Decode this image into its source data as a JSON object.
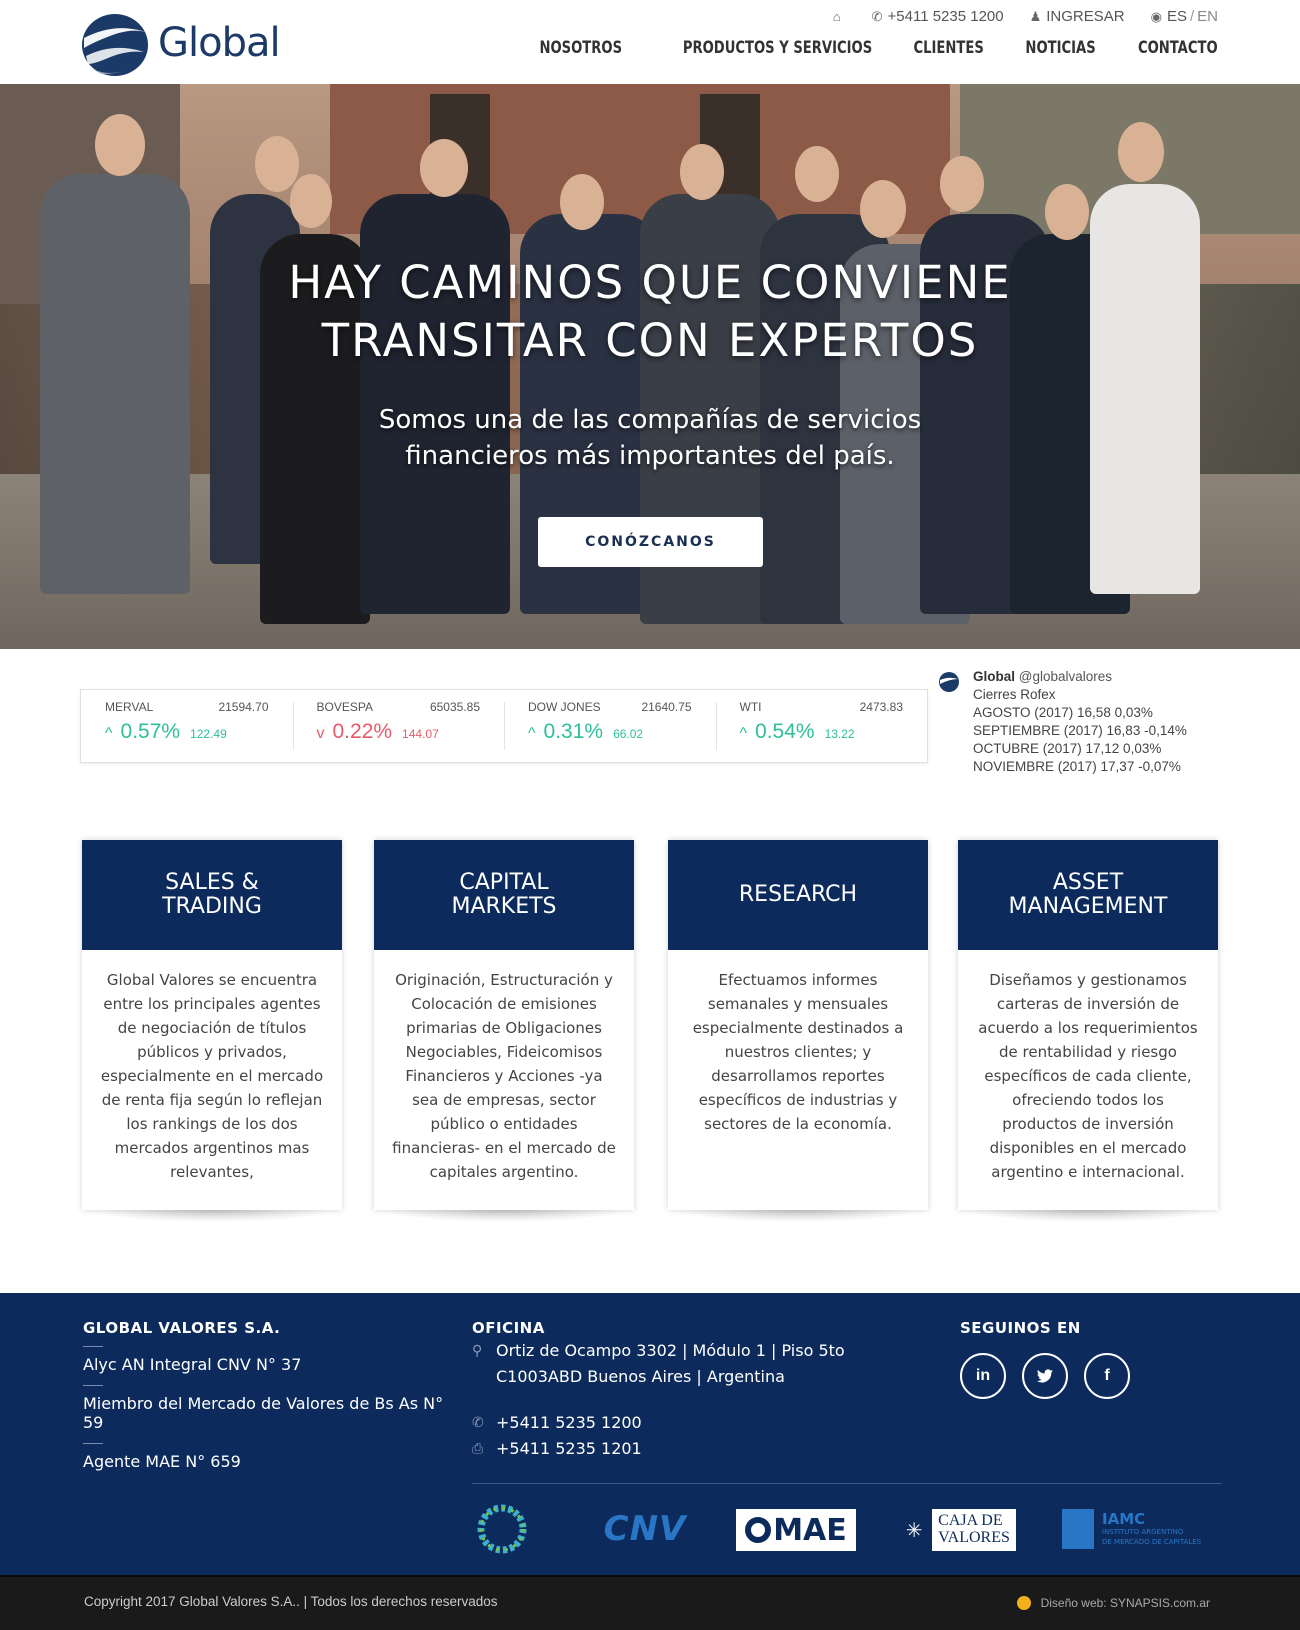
{
  "header": {
    "logo_text": "Global",
    "phone": "+5411 5235 1200",
    "login": "INGRESAR",
    "lang_es": "ES",
    "lang_sep": "/",
    "lang_en": "EN",
    "nav": [
      "NOSOTROS",
      "PRODUCTOS Y SERVICIOS",
      "CLIENTES",
      "NOTICIAS",
      "CONTACTO"
    ]
  },
  "hero": {
    "title_line1": "HAY CAMINOS QUE CONVIENE",
    "title_line2": "TRANSITAR CON EXPERTOS",
    "subtitle_line1": "Somos una de las compañías de servicios",
    "subtitle_line2": "financieros más importantes del país.",
    "button": "CONÓZCANOS"
  },
  "ticker": [
    {
      "name": "MERVAL",
      "value": "21594.70",
      "pct": "0.57%",
      "change": "122.49",
      "dir": "up",
      "arrow": "^"
    },
    {
      "name": "BOVESPA",
      "value": "65035.85",
      "pct": "0.22%",
      "change": "144.07",
      "dir": "down",
      "arrow": "v"
    },
    {
      "name": "DOW JONES",
      "value": "21640.75",
      "pct": "0.31%",
      "change": "66.02",
      "dir": "up",
      "arrow": "^"
    },
    {
      "name": "WTI",
      "value": "2473.83",
      "pct": "0.54%",
      "change": "13.22",
      "dir": "up",
      "arrow": "^"
    }
  ],
  "tweet": {
    "name": "Global",
    "handle": "@globalvalores",
    "lines": [
      "Cierres Rofex",
      "AGOSTO (2017) 16,58 0,03%",
      "SEPTIEMBRE (2017) 16,83 -0,14%",
      "OCTUBRE (2017) 17,12 0,03%",
      "NOVIEMBRE (2017) 17,37 -0,07%"
    ]
  },
  "cards": [
    {
      "title_line1": "SALES &",
      "title_line2": "TRADING",
      "body": "Global Valores se encuentra entre los principales agentes de negociación de títulos públicos y privados, especialmente en el mercado de renta fija según lo reflejan los rankings de los dos mercados argentinos mas relevantes,"
    },
    {
      "title_line1": "CAPITAL",
      "title_line2": "MARKETS",
      "body": "Originación, Estructuración y Colocación de emisiones primarias de Obligaciones Negociables, Fideicomisos Financieros y Acciones -ya sea de empresas, sector público o entidades financieras- en el mercado de capitales argentino."
    },
    {
      "title_line1": "RESEARCH",
      "title_line2": "",
      "body": "Efectuamos informes semanales y mensuales especialmente destinados a nuestros clientes; y desarrollamos reportes específicos de industrias y sectores de la economía."
    },
    {
      "title_line1": "ASSET",
      "title_line2": "MANAGEMENT",
      "body": "Diseñamos y gestionamos carteras de inversión de acuerdo a los requerimientos de rentabilidad y riesgo específicos de cada cliente, ofreciendo todos los productos de inversión disponibles en el mercado argentino e internacional."
    }
  ],
  "footer": {
    "company_title": "GLOBAL VALORES S.A.",
    "company_lines": [
      "Alyc AN Integral CNV N° 37",
      "Miembro del Mercado de Valores de Bs As N° 59",
      "Agente MAE N° 659"
    ],
    "office_title": "OFICINA",
    "address_line1": "Ortiz de Ocampo 3302 | Módulo 1 | Piso 5to",
    "address_line2": "C1003ABD Buenos Aires | Argentina",
    "phone": "+5411 5235 1200",
    "fax": "+5411 5235 1201",
    "follow_title": "SEGUINOS EN",
    "social": [
      "in",
      "t",
      "f"
    ],
    "logo_cnv": "CNV",
    "logo_mae": "MAE",
    "logo_caja_1": "CAJA DE",
    "logo_caja_2": "VALORES",
    "logo_iamc": "IAMC",
    "logo_iamc_sub1": "INSTITUTO ARGENTINO",
    "logo_iamc_sub2": "DE MERCADO DE CAPITALES",
    "copyright": "Copyright 2017 Global Valores S.A.. | Todos los derechos reservados",
    "design": "Diseño web: SYNAPSIS.com.ar"
  },
  "colors": {
    "navy": "#0c2b5c",
    "up": "#2cbf9a",
    "down": "#e55a6a"
  },
  "icons": [
    "home-icon",
    "phone-icon",
    "user-icon",
    "globe-icon",
    "map-pin-icon",
    "fax-icon",
    "linkedin-icon",
    "twitter-icon",
    "facebook-icon"
  ]
}
